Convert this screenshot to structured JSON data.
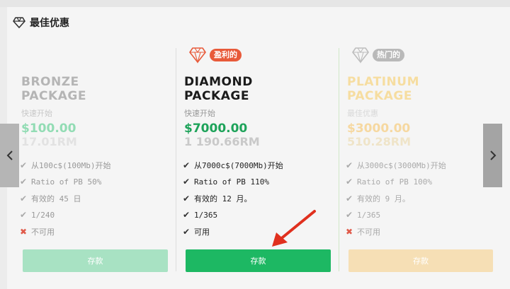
{
  "section": {
    "title": "最佳优惠",
    "icon": "diamond-icon"
  },
  "packages": [
    {
      "name_line1": "BRONZE",
      "name_line2": "PACKAGE",
      "subtitle": "快速开始",
      "price": "$100.00",
      "price_rm": "17.01RM",
      "badge": "",
      "features": [
        {
          "text": "从100c$(100Mb)开始",
          "ok": true
        },
        {
          "text": "Ratio of PB 50%",
          "ok": true
        },
        {
          "text": "有效的 45 日",
          "ok": true
        },
        {
          "text": "1/240",
          "ok": true
        },
        {
          "text": "不可用",
          "ok": false
        }
      ],
      "button": "存款"
    },
    {
      "name_line1": "DIAMOND",
      "name_line2": "PACKAGE",
      "subtitle": "快速开始",
      "price": "$7000.00",
      "price_rm": "1 190.66RM",
      "badge": "盈利的",
      "features": [
        {
          "text": "从7000c$(7000Mb)开始",
          "ok": true
        },
        {
          "text": "Ratio of PB 110%",
          "ok": true
        },
        {
          "text": "有效的 12 月。",
          "ok": true
        },
        {
          "text": "1/365",
          "ok": true
        },
        {
          "text": "可用",
          "ok": true
        }
      ],
      "button": "存款"
    },
    {
      "name_line1": "PLATINUM",
      "name_line2": "PACKAGE",
      "subtitle": "最佳优惠",
      "price": "$3000.00",
      "price_rm": "510.28RM",
      "badge": "热门的",
      "features": [
        {
          "text": "从3000c$(3000Mb)开始",
          "ok": true
        },
        {
          "text": "Ratio of PB 100%",
          "ok": true
        },
        {
          "text": "有效的 9 月。",
          "ok": true
        },
        {
          "text": "1/365",
          "ok": true
        },
        {
          "text": "不可用",
          "ok": false
        }
      ],
      "button": "存款"
    }
  ],
  "nav": {
    "prev_icon": "chevron-left-icon",
    "next_icon": "chevron-right-icon"
  },
  "colors": {
    "green": "#1db863",
    "badge_red": "#e85a3a",
    "badge_gray": "#b9b9b9",
    "arrow_red": "#e0301e"
  }
}
